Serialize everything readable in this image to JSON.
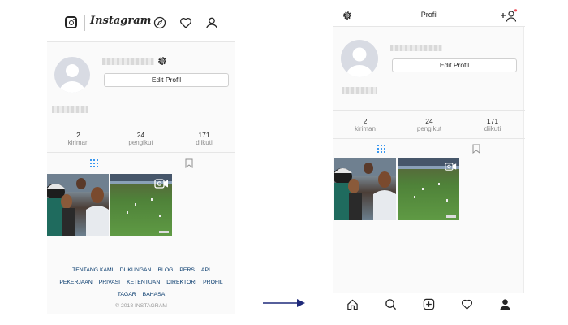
{
  "web_profile": {
    "header": {
      "logo_wordmark": "Instagram",
      "icons": [
        "explore-compass-icon",
        "activity-heart-icon",
        "profile-person-icon"
      ]
    },
    "edit_profile_label": "Edit Profil",
    "stats": [
      {
        "value": "2",
        "label": "kiriman"
      },
      {
        "value": "24",
        "label": "pengikut"
      },
      {
        "value": "171",
        "label": "diikuti"
      }
    ],
    "footer": {
      "line1": [
        "TENTANG KAMI",
        "DUKUNGAN",
        "BLOG",
        "PERS",
        "API"
      ],
      "line2": [
        "PEKERJAAN",
        "PRIVASI",
        "KETENTUAN",
        "DIREKTORI",
        "PROFIL"
      ],
      "line3": [
        "TAGAR",
        "BAHASA"
      ],
      "copyright": "© 2018 INSTAGRAM"
    }
  },
  "app_profile": {
    "header": {
      "title": "Profil"
    },
    "edit_profile_label": "Edit Profil",
    "stats": [
      {
        "value": "2",
        "label": "kiriman"
      },
      {
        "value": "24",
        "label": "pengikut"
      },
      {
        "value": "171",
        "label": "diikuti"
      }
    ],
    "bottom_nav": [
      "home-icon",
      "search-icon",
      "new-post-icon",
      "activity-heart-icon",
      "profile-icon"
    ]
  },
  "colors": {
    "accent": "#3897f0",
    "link": "#003569",
    "arrow": "#1f2a7a",
    "notification_dot": "#ed4956"
  }
}
